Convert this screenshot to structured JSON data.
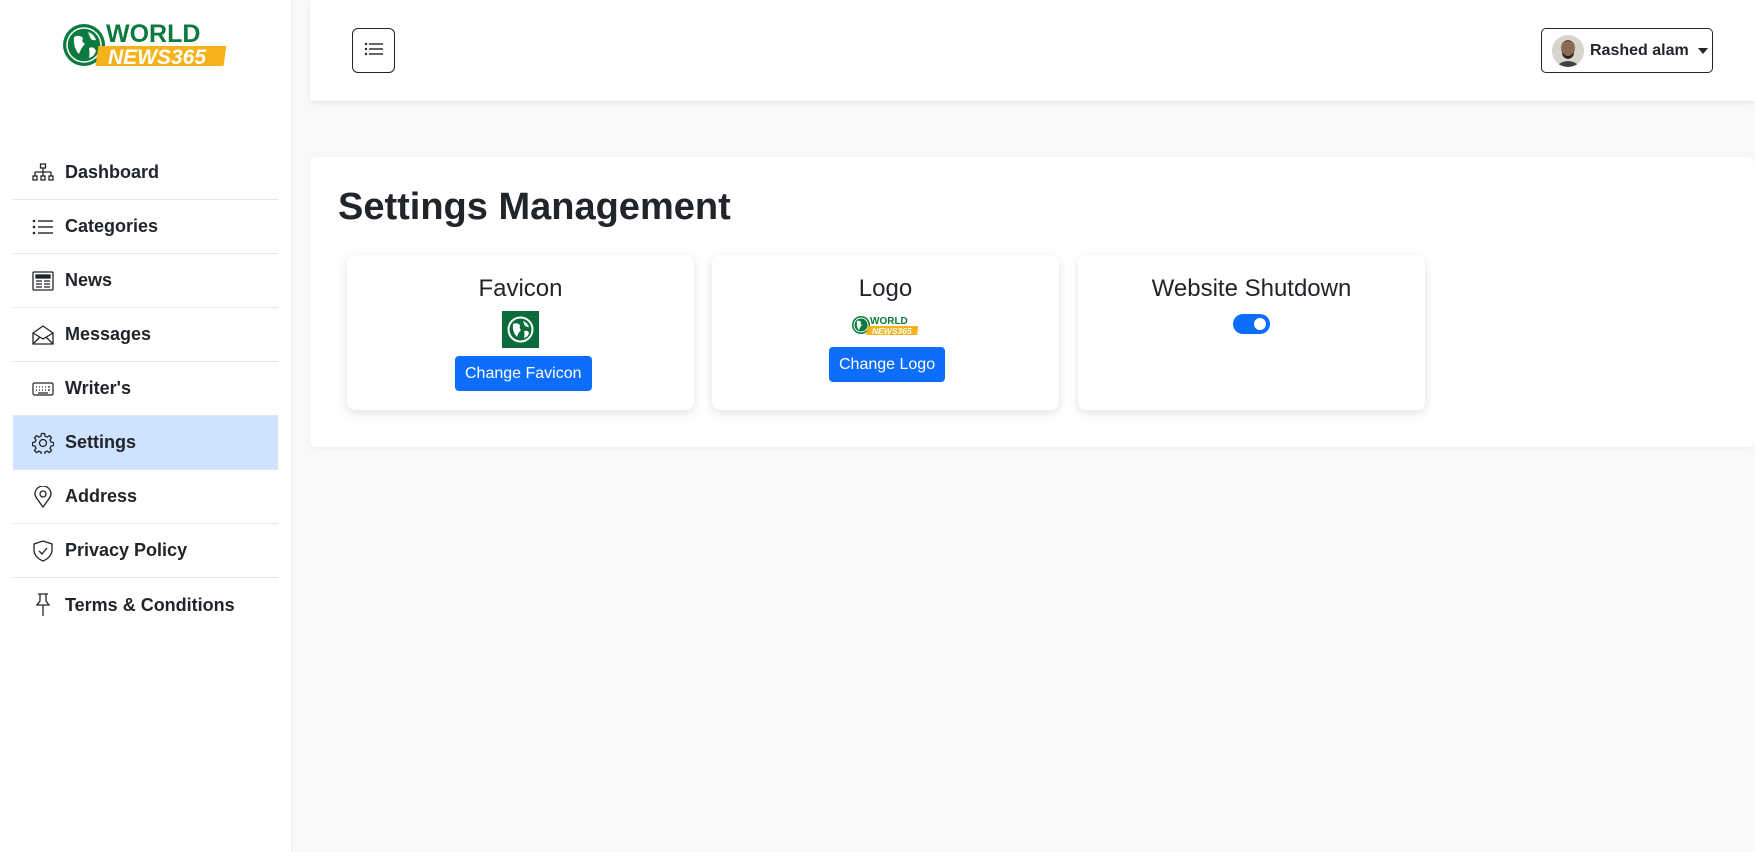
{
  "brand": {
    "line1": "WORLD",
    "line2": "NEWS365",
    "green": "#0b7a3e",
    "yellow": "#f5b21a"
  },
  "sidebar": {
    "items": [
      {
        "label": "Dashboard",
        "icon": "sitemap-icon",
        "active": false
      },
      {
        "label": "Categories",
        "icon": "list-icon",
        "active": false
      },
      {
        "label": "News",
        "icon": "newspaper-icon",
        "active": false
      },
      {
        "label": "Messages",
        "icon": "envelope-icon",
        "active": false
      },
      {
        "label": "Writer's",
        "icon": "keyboard-icon",
        "active": false
      },
      {
        "label": "Settings",
        "icon": "gear-icon",
        "active": true
      },
      {
        "label": "Address",
        "icon": "location-pin-icon",
        "active": false
      },
      {
        "label": "Privacy Policy",
        "icon": "shield-check-icon",
        "active": false
      },
      {
        "label": "Terms & Conditions",
        "icon": "pin-icon",
        "active": false
      }
    ]
  },
  "header": {
    "toggle_icon": "list-icon",
    "user_name": "Rashed alam",
    "user_avatar": "avatar-photo"
  },
  "main": {
    "title": "Settings Management",
    "cards": {
      "favicon": {
        "title": "Favicon",
        "button": "Change Favicon"
      },
      "logo": {
        "title": "Logo",
        "button": "Change Logo"
      },
      "shutdown": {
        "title": "Website Shutdown",
        "enabled": true
      }
    }
  },
  "colors": {
    "primary": "#0d6efd",
    "active_bg": "#cfe2ff"
  }
}
